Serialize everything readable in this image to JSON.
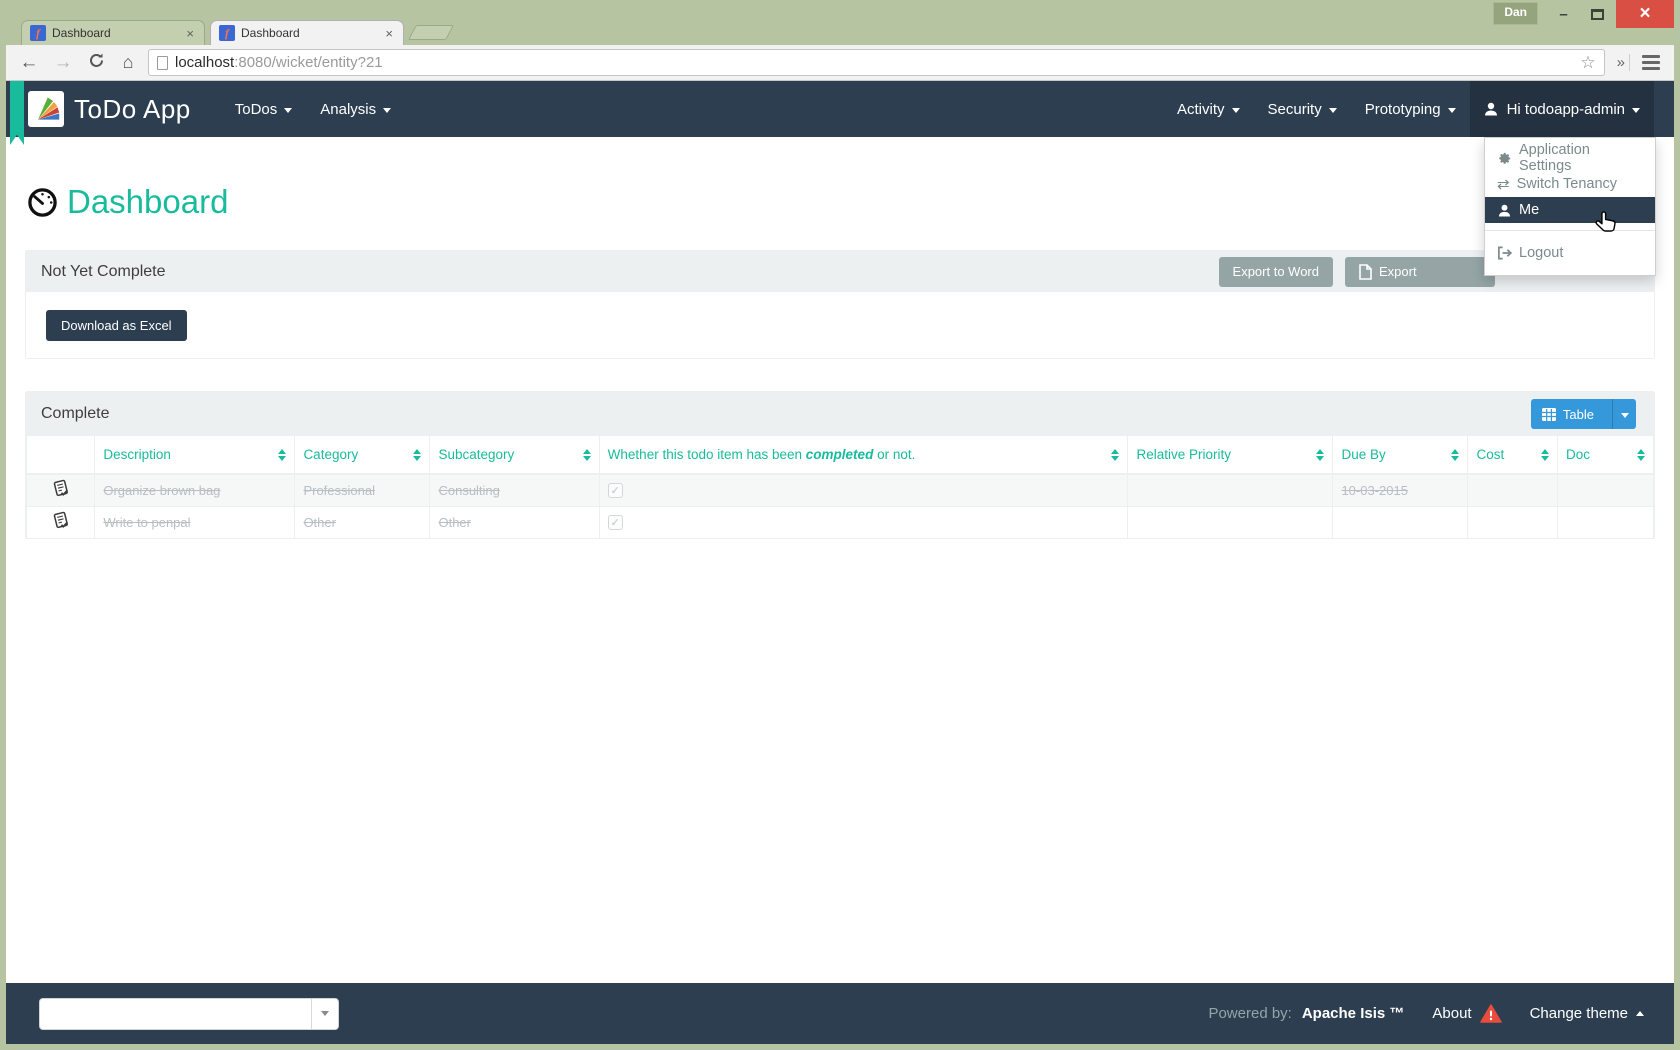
{
  "theme": {
    "navy": "#2C3E50",
    "teal": "#18BC9C",
    "blue": "#3498DB",
    "red": "#E74C3C",
    "gray_button": "#95A5A6",
    "panel_heading_bg": "#ECF0F1",
    "frame_green": "#B6C4A1"
  },
  "browser": {
    "window_profile": "Dan",
    "tabs": [
      {
        "title": "Dashboard"
      },
      {
        "title": "Dashboard"
      }
    ],
    "url": {
      "host": "localhost",
      "rest": ":8080/wicket/entity?21"
    }
  },
  "icons": {
    "close_tab": "×",
    "back": "←",
    "forward": "→",
    "home": "⌂",
    "star": "☆",
    "overflow": "»",
    "window_min": "–",
    "window_close": "×",
    "swap": "⇄",
    "favicon_glyph": "f"
  },
  "navbar": {
    "brand": "ToDo App",
    "menus": [
      {
        "label": "ToDos"
      },
      {
        "label": "Analysis"
      }
    ],
    "right_menus": [
      {
        "label": "Activity"
      },
      {
        "label": "Security"
      },
      {
        "label": "Prototyping"
      }
    ],
    "user": "Hi todoapp-admin"
  },
  "user_menu": {
    "app_settings": "Application Settings",
    "switch_tenancy": "Switch Tenancy",
    "me": "Me",
    "logout": "Logout"
  },
  "page": {
    "title": "Dashboard"
  },
  "not_yet_complete": {
    "title": "Not Yet Complete",
    "export_word": "Export to Word",
    "export_partial": "Export",
    "download_excel": "Download as Excel"
  },
  "complete": {
    "title": "Complete",
    "view_button": "Table",
    "columns": {
      "description": "Description",
      "category": "Category",
      "subcategory": "Subcategory",
      "completed_prefix": "Whether this todo item has been ",
      "completed_em": "completed",
      "completed_suffix": " or not.",
      "relative_priority": "Relative Priority",
      "due_by": "Due By",
      "cost": "Cost",
      "doc": "Doc"
    },
    "rows": [
      {
        "description": "Organize brown bag",
        "category": "Professional",
        "subcategory": "Consulting",
        "completed_mark": "✓",
        "relative_priority": "",
        "due_by": "10-03-2015",
        "cost": "",
        "doc": ""
      },
      {
        "description": "Write to penpal",
        "category": "Other",
        "subcategory": "Other",
        "completed_mark": "✓",
        "relative_priority": "",
        "due_by": "",
        "cost": "",
        "doc": ""
      }
    ]
  },
  "footer": {
    "powered_by": "Powered by:",
    "brand": "Apache Isis ™",
    "about": "About",
    "change_theme": "Change theme"
  }
}
